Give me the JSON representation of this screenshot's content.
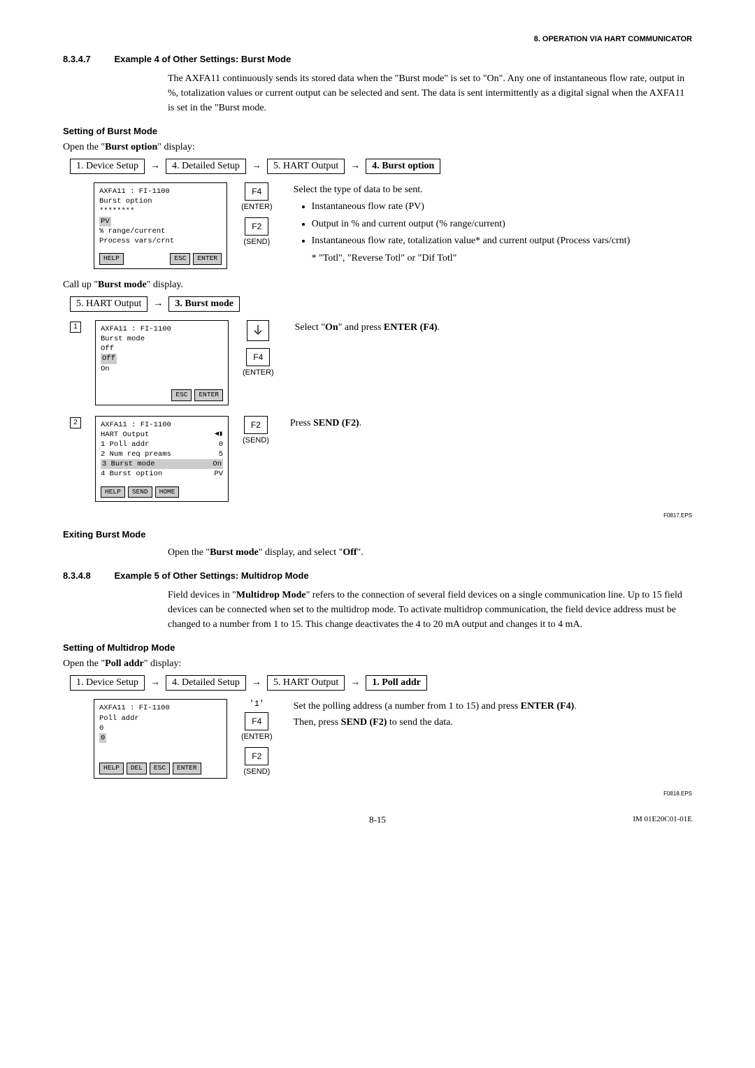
{
  "header": "8.  OPERATION VIA HART COMMUNICATOR",
  "s1": {
    "num": "8.3.4.7",
    "title": "Example 4 of Other Settings: Burst Mode",
    "para": "The AXFA11 continuously sends its stored data when the \"Burst mode\" is set to \"On\". Any one of instantaneous flow rate, output in %, totalization values or current output can be selected and sent. The data is sent intermittently as a digital signal when the AXFA11 is set in the \"Burst mode."
  },
  "sub1": "Setting of Burst Mode",
  "open1_pre": "Open the \"",
  "open1_b": "Burst option",
  "open1_post": "\" display:",
  "bc1": {
    "a": "1. Device Setup",
    "b": "4. Detailed Setup",
    "c": "5. HART Output",
    "d": "4.  Burst option"
  },
  "screen1": {
    "l1": "AXFA11 : FI-1100",
    "l2": "Burst option",
    "l3": "********",
    "opt1": "PV",
    "opt2": "% range/current",
    "opt3": "Process vars/crnt",
    "b1": "HELP",
    "b2": "ESC",
    "b3": "ENTER"
  },
  "keys1": {
    "k1": "F4",
    "k1l": "(ENTER)",
    "k2": "F2",
    "k2l": "(SEND)"
  },
  "desc1": {
    "intro": "Select the type of data to be sent.",
    "li1": "Instantaneous flow rate (PV)",
    "li2": "Output in % and current output (% range/current)",
    "li3": "Instantaneous flow rate, totalization value* and current output (Process vars/crnt)",
    "note": "* \"Totl\", \"Reverse Totl\" or \"Dif Totl\""
  },
  "call2_pre": "Call up \"",
  "call2_b": "Burst mode",
  "call2_post": "\" display.",
  "bc2": {
    "a": "5. HART Output",
    "b": "3.  Burst mode"
  },
  "step1_n": "1",
  "screen2": {
    "l1": "AXFA11 : FI-1100",
    "l2": "Burst mode",
    "l3": "Off",
    "opt1": "Off",
    "opt2": "On",
    "b1": "ESC",
    "b2": "ENTER"
  },
  "keys2": {
    "k1": "F4",
    "k1l": "(ENTER)"
  },
  "desc2_a": "Select \"",
  "desc2_b": "On",
  "desc2_c": "\" and press ",
  "desc2_d": "ENTER (F4)",
  "desc2_e": ".",
  "step2_n": "2",
  "screen3": {
    "l1": "AXFA11 : FI-1100",
    "l2": "HART Output",
    "m1a": "1 Poll addr",
    "m1b": "0",
    "m2a": "2 Num req preams",
    "m2b": "5",
    "m3a": "3 Burst mode",
    "m3b": "On",
    "m4a": "4 Burst option",
    "m4b": "PV",
    "b1": "HELP",
    "b2": "SEND",
    "b3": "HOME"
  },
  "keys3": {
    "k1": "F2",
    "k1l": "(SEND)"
  },
  "desc3_a": "Press ",
  "desc3_b": "SEND (F2)",
  "desc3_c": ".",
  "fig1": "F0817.EPS",
  "sub2": "Exiting Burst Mode",
  "exit_a": "Open the \"",
  "exit_b": "Burst mode",
  "exit_c": "\" display, and select \"",
  "exit_d": "Off",
  "exit_e": "\".",
  "s2": {
    "num": "8.3.4.8",
    "title": "Example 5 of Other Settings: Multidrop Mode",
    "para_a": "Field devices in \"",
    "para_b": "Multidrop Mode",
    "para_c": "\" refers to the connection of several field devices on a single communication line. Up to 15 field devices can be connected when set to the multidrop mode. To activate multidrop communication, the field device address must be changed to a number from 1 to 15. This change deactivates the 4 to 20 mA output and changes it to 4 mA."
  },
  "sub3": "Setting of Multidrop Mode",
  "open3_pre": "Open the \"",
  "open3_b": "Poll addr",
  "open3_post": "\" display:",
  "bc3": {
    "a": "1. Device Setup",
    "b": "4. Detailed Setup",
    "c": "5. HART Output",
    "d": "1.  Poll addr"
  },
  "screen4": {
    "l1": "AXFA11 : FI-1100",
    "l2": "Poll addr",
    "l3": "0",
    "val": "0",
    "b1": "HELP",
    "b2": "DEL",
    "b3": "ESC",
    "b4": "ENTER"
  },
  "keys4": {
    "top": "'1'",
    "k1": "F4",
    "k1l": "(ENTER)",
    "k2": "F2",
    "k2l": "(SEND)"
  },
  "desc4_a": "Set the polling address (a number from 1 to 15) and press ",
  "desc4_b": "ENTER (F4)",
  "desc4_c": ".",
  "desc4_d": "Then, press ",
  "desc4_e": "SEND (F2)",
  "desc4_f": " to send the data.",
  "fig2": "F0818.EPS",
  "page": "8-15",
  "pub": "IM 01E20C01-01E"
}
